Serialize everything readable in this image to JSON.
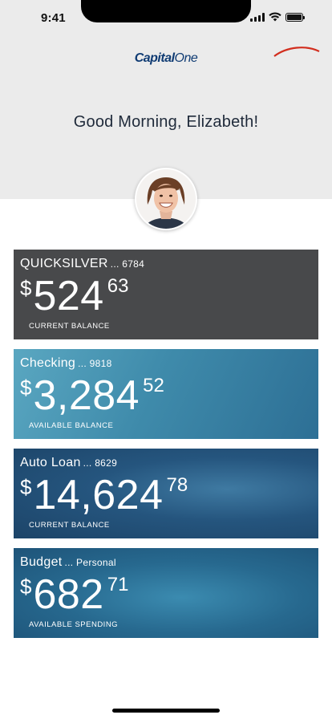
{
  "status_bar": {
    "time": "9:41"
  },
  "header": {
    "logo_text_a": "Capital",
    "logo_text_b": "One",
    "greeting": "Good Morning, Elizabeth!"
  },
  "accounts": [
    {
      "name": "QUICKSILVER",
      "suffix": "... 6784",
      "currency": "$",
      "whole": "524",
      "cents": "63",
      "label": "CURRENT BALANCE"
    },
    {
      "name": "Checking",
      "suffix": "... 9818",
      "currency": "$",
      "whole": "3,284",
      "cents": "52",
      "label": "AVAILABLE BALANCE"
    },
    {
      "name": "Auto Loan",
      "suffix": "... 8629",
      "currency": "$",
      "whole": "14,624",
      "cents": "78",
      "label": "CURRENT BALANCE"
    },
    {
      "name": "Budget",
      "suffix": "... Personal",
      "currency": "$",
      "whole": "682",
      "cents": "71",
      "label": "AVAILABLE SPENDING"
    }
  ],
  "colors": {
    "brand_navy": "#0f3b73",
    "brand_red": "#d22e1e",
    "header_bg": "#ebebeb"
  }
}
